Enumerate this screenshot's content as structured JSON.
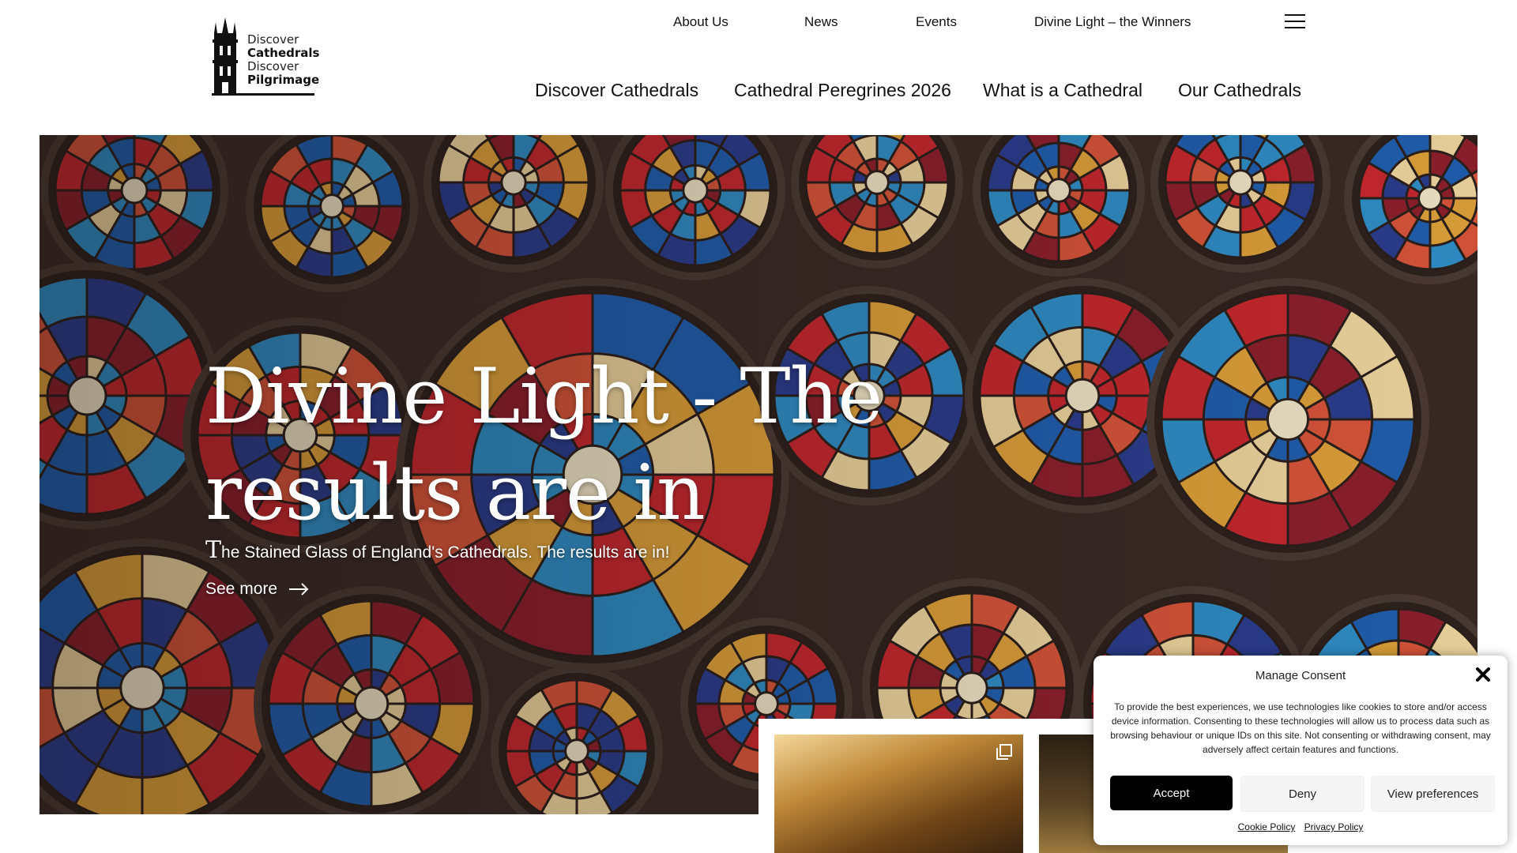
{
  "logo": {
    "line1": "Discover",
    "line2": "Cathedrals",
    "line3": "Discover",
    "line4": "Pilgrimage"
  },
  "top_nav": [
    "About Us",
    "News",
    "Events",
    "Divine Light – the Winners"
  ],
  "main_nav": [
    "Discover Cathedrals",
    "Cathedral Peregrines 2026",
    "What is a Cathedral",
    "Our Cathedrals"
  ],
  "hero": {
    "title": "Divine Light - The results are in",
    "subtitle_initial": "T",
    "subtitle_rest": "he Stained Glass of England's Cathedrals. The results are in!",
    "cta": "See more"
  },
  "consent": {
    "title": "Manage Consent",
    "body": "To provide the best experiences, we use technologies like cookies to store and/or access device information. Consenting to these technologies will allow us to process data such as browsing behaviour or unique IDs on this site. Not consenting or withdrawing consent, may adversely affect certain features and functions.",
    "accept": "Accept",
    "deny": "Deny",
    "preferences": "View preferences",
    "cookie_policy": "Cookie Policy",
    "privacy_policy": "Privacy Policy"
  },
  "colors": {
    "accept_bg": "#000000",
    "secondary_btn_bg": "#f5f5f5",
    "hero_tint": "#3a2a26"
  },
  "icons": [
    "cathedral-tower-icon",
    "hamburger-menu-icon",
    "arrow-right-icon",
    "close-icon",
    "multiple-images-icon"
  ]
}
